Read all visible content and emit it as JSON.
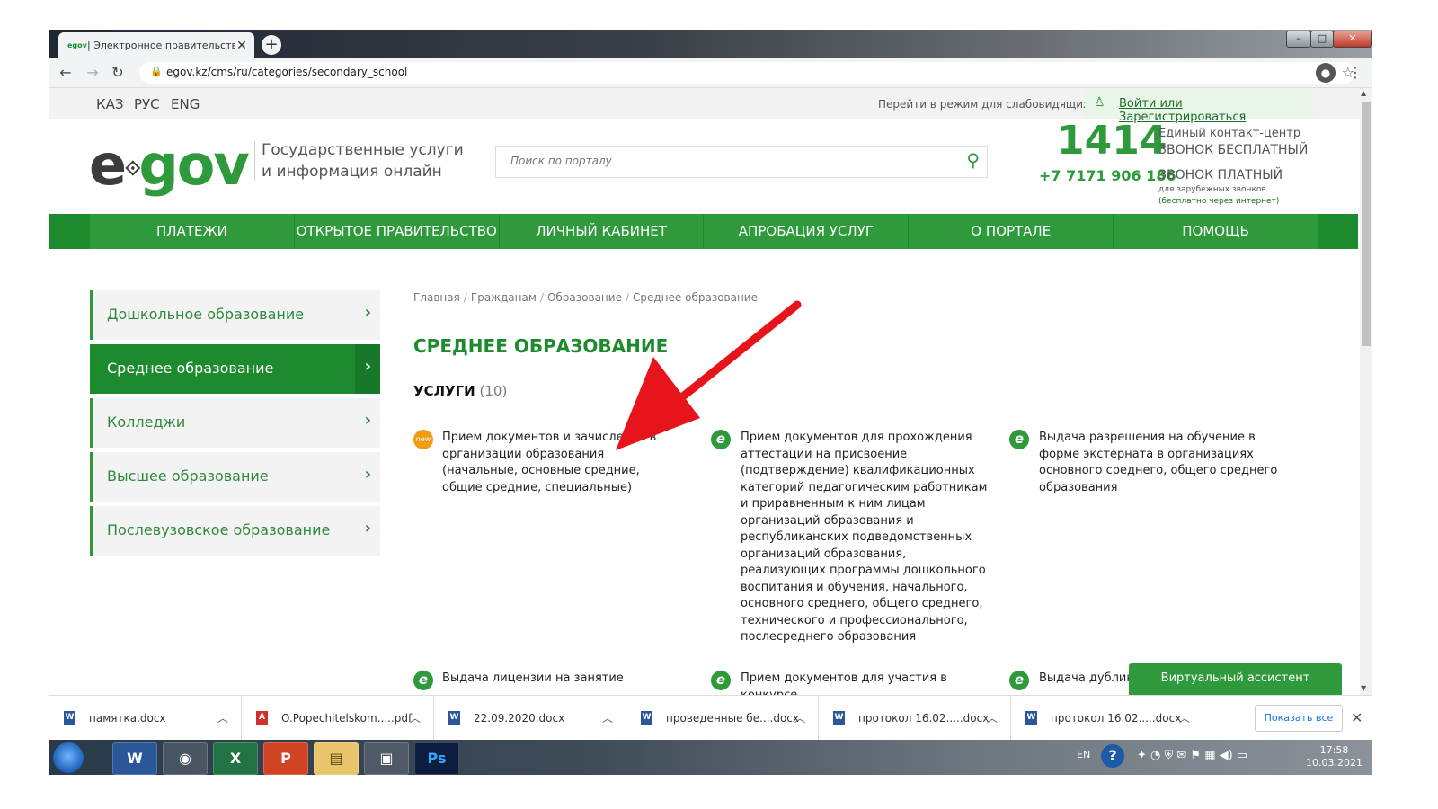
{
  "browser": {
    "tab_title": "| Электронное правительство Р",
    "tab_favicon": "egov",
    "url": "egov.kz/cms/ru/categories/secondary_school"
  },
  "utility": {
    "languages": [
      "КАЗ",
      "РУС",
      "ENG"
    ],
    "vision_mode": "Перейти в режим для слабовидящих",
    "login": "Войти или Зарегистрироваться"
  },
  "header": {
    "logo_e": "e",
    "logo_gov": "gov",
    "tagline_line1": "Государственные услуги",
    "tagline_line2": "и информация онлайн",
    "search_placeholder": "Поиск по порталу",
    "contact_number": "1414",
    "contact_line1": "Единый контакт-центр",
    "contact_line2": "ЗВОНОК БЕСПЛАТНЫЙ",
    "phone": "+7 7171 906 186",
    "contact_line3": "ЗВОНОК ПЛАТНЫЙ",
    "contact_line4": "для зарубежных звонков",
    "contact_line5": "(бесплатно через интернет)"
  },
  "nav": [
    "ПЛАТЕЖИ",
    "ОТКРЫТОЕ ПРАВИТЕЛЬСТВО",
    "ЛИЧНЫЙ КАБИНЕТ",
    "АПРОБАЦИЯ УСЛУГ",
    "О ПОРТАЛЕ",
    "ПОМОЩЬ"
  ],
  "sidebar": [
    {
      "label": "Дошкольное образование",
      "active": false
    },
    {
      "label": "Среднее образование",
      "active": true
    },
    {
      "label": "Колледжи",
      "active": false
    },
    {
      "label": "Высшее образование",
      "active": false
    },
    {
      "label": "Послевузовское образование",
      "active": false
    }
  ],
  "breadcrumb": [
    "Главная",
    "Гражданам",
    "Образование",
    "Среднее образование"
  ],
  "page_title": "СРЕДНЕЕ ОБРАЗОВАНИЕ",
  "services_label": "УСЛУГИ",
  "services_count": "(10)",
  "services": [
    {
      "badge": "new",
      "text": "Прием документов и зачисление в организации образования (начальные, основные средние, общие средние, специальные)"
    },
    {
      "badge": "e",
      "text": "Прием документов для прохождения аттестации на присвоение (подтверждение) квалификационных категорий педагогическим работникам и приравненным к ним лицам организаций образования и республиканских подведомственных организаций образования, реализующих программы дошкольного воспитания и обучения, начального, основного среднего, общего среднего, технического и профессионального, послесреднего образования"
    },
    {
      "badge": "e",
      "text": "Выдача разрешения на обучение в форме экстерната в организациях основного среднего, общего среднего образования"
    },
    {
      "badge": "e",
      "text": "Выдача лицензии на занятие"
    },
    {
      "badge": "e",
      "text": "Прием документов для участия в конкурсе"
    },
    {
      "badge": "e",
      "text": "Выдача дублика"
    }
  ],
  "assistant": "Виртуальный ассистент",
  "downloads": [
    {
      "name": "памятка.docx",
      "type": "W"
    },
    {
      "name": "O.Popechitelskom.....pdf",
      "type": "pdf"
    },
    {
      "name": "22.09.2020.docx",
      "type": "W"
    },
    {
      "name": "проведенные бе....docx",
      "type": "W"
    },
    {
      "name": "протокол  16.02.....docx",
      "type": "W"
    },
    {
      "name": "протокол 16.02.....docx",
      "type": "W"
    }
  ],
  "show_all": "Показать все",
  "taskbar": {
    "apps": [
      "W",
      "◉",
      "X",
      "P",
      "▤",
      "▣",
      "Ps"
    ],
    "lang": "EN",
    "time": "17:58",
    "date": "10.03.2021"
  },
  "colors": {
    "brand_green": "#2e9a3c",
    "dark_green": "#1e8a2e",
    "arrow_red": "#e8141c",
    "new_badge": "#f39c12"
  }
}
